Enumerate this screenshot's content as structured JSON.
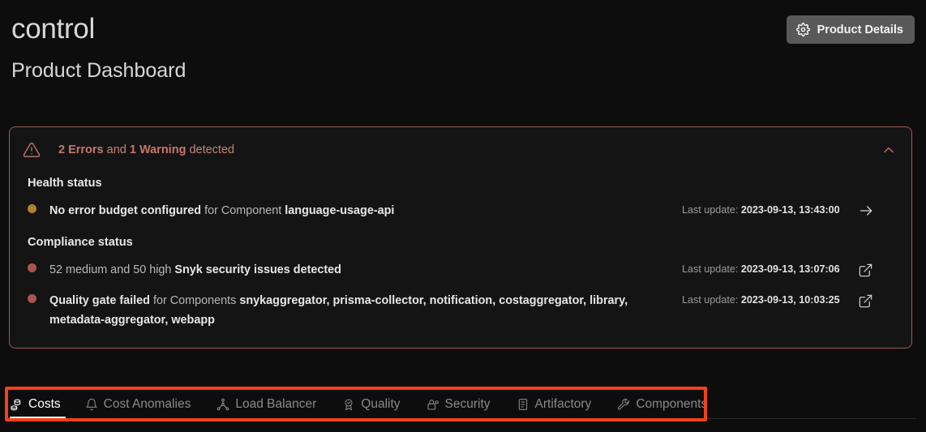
{
  "header": {
    "app_title": "control",
    "page_subtitle": "Product Dashboard",
    "product_details_label": "Product Details",
    "gear_icon": "gear-icon"
  },
  "alert": {
    "warning_icon": "warning-triangle-icon",
    "collapse_icon": "chevron-up-icon",
    "summary": {
      "errors_count": "2 Errors",
      "conjunction": " and ",
      "warnings_count": "1 Warning",
      "suffix": " detected"
    },
    "sections": [
      {
        "title": "Health status",
        "rows": [
          {
            "severity": "amber",
            "text_bold_1": "No error budget configured",
            "text_plain_1": " for Component ",
            "text_bold_2": "language-usage-api",
            "last_update_label": "Last update: ",
            "last_update_value": "2023-09-13, 13:43:00",
            "action_icon": "arrow-right-icon"
          }
        ]
      },
      {
        "title": "Compliance status",
        "rows": [
          {
            "severity": "red",
            "text_plain_1": "52 medium and 50 high ",
            "text_bold_1": "Snyk security issues detected",
            "last_update_label": "Last update: ",
            "last_update_value": "2023-09-13, 13:07:06",
            "action_icon": "external-link-icon"
          },
          {
            "severity": "red",
            "text_bold_1": "Quality gate failed",
            "text_plain_1": " for Components ",
            "text_bold_2": "snykaggregator, prisma-collector, notification, costaggregator, library, metadata-aggregator, webapp",
            "last_update_label": "Last update: ",
            "last_update_value": "2023-09-13, 10:03:25",
            "action_icon": "external-link-icon"
          }
        ]
      }
    ]
  },
  "tabs": {
    "highlight_color": "#f2411b",
    "items": [
      {
        "label": "Costs",
        "icon": "coins-icon",
        "active": true
      },
      {
        "label": "Cost Anomalies",
        "icon": "bell-icon",
        "active": false
      },
      {
        "label": "Load Balancer",
        "icon": "network-nodes-icon",
        "active": false
      },
      {
        "label": "Quality",
        "icon": "award-badge-icon",
        "active": false
      },
      {
        "label": "Security",
        "icon": "lock-shield-icon",
        "active": false
      },
      {
        "label": "Artifactory",
        "icon": "document-icon",
        "active": false
      },
      {
        "label": "Components",
        "icon": "wrench-icon",
        "active": false
      }
    ]
  },
  "colors": {
    "page_background": "#0d0d0d",
    "banner_background": "#141414",
    "banner_border": "#9e5a52",
    "alert_text": "#c78378",
    "amber_bullet": "#b5802f",
    "red_bullet": "#a5564f",
    "accent_highlight": "#f2411b",
    "button_background": "#595959"
  }
}
